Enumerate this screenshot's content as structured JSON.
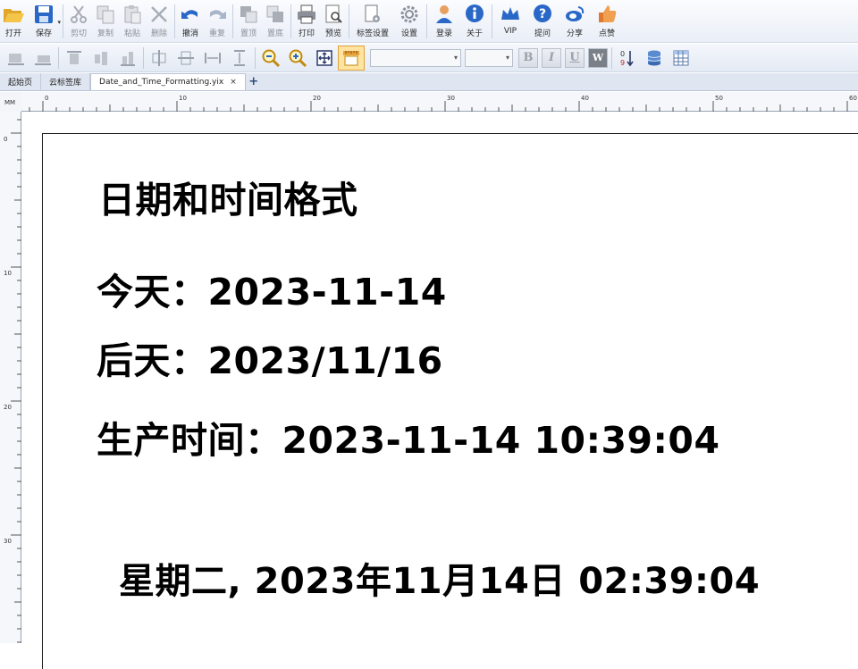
{
  "toolbar": {
    "open": "打开",
    "save": "保存",
    "cut": "剪切",
    "copy": "复制",
    "paste": "粘贴",
    "delete": "删除",
    "undo": "撤消",
    "redo": "重复",
    "bring_front": "置顶",
    "send_back": "置底",
    "print": "打印",
    "preview": "预览",
    "label_settings": "标签设置",
    "settings": "设置",
    "login": "登录",
    "about": "关于",
    "vip": "VIP",
    "question": "提问",
    "share": "分享",
    "like": "点赞"
  },
  "tabs": {
    "start": "起始页",
    "cloud": "云标签库",
    "document": "Date_and_Time_Formatting.yix",
    "close": "×",
    "add": "+"
  },
  "ruler": {
    "unit": "MM",
    "h_labels": [
      "0",
      "10",
      "20",
      "30",
      "40",
      "50",
      "60"
    ],
    "v_labels": [
      "0",
      "10",
      "20",
      "30"
    ]
  },
  "format": {
    "bold": "B",
    "italic": "I",
    "underline": "U",
    "wordwrap": "W",
    "sort": "0 9"
  },
  "label": {
    "title": "日期和时间格式",
    "today": "今天：2023-11-14",
    "after_tomorrow": "后天：2023/11/16",
    "production_time": "生产时间：2023-11-14 10:39:04",
    "weekday_datetime": "星期二, 2023年11月14日 02:39:04"
  },
  "colors": {
    "accent_blue": "#2a68c8",
    "active_tool": "#ffe3a0",
    "toolbar_bg": "#e9eef7"
  }
}
